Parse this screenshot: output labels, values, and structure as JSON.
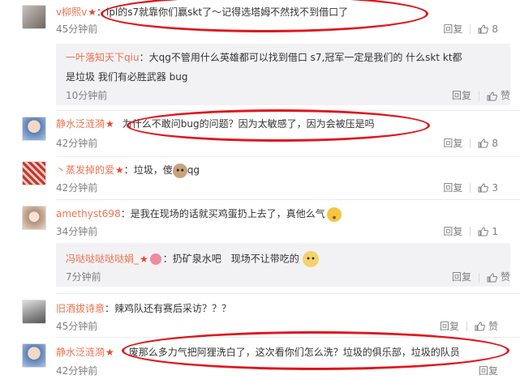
{
  "comments": [
    {
      "name": "v柳熙v",
      "badge": "★",
      "sep": "：",
      "text": "lpl的s7就靠你们赢skt了～记得选塔姆不然找不到借口了",
      "time": "45分钟前",
      "reply": "回复",
      "likes": "8"
    },
    {
      "name": "一叶落知天下qiu",
      "sep": "：",
      "text_line1": "大qg不管用什么英雄都可以找到借口 s7,冠军一定是我们的 什么skt kt都",
      "text_line2": "是垃圾 我们有必胜武器 bug",
      "time": "10分钟前",
      "reply": "回复",
      "like_label": "赞"
    },
    {
      "name": "静水泛涟漪",
      "badge": "★",
      "text": "为什么不敢问bug的问题？因为太敏感了，因为会被压是吗",
      "time": "42分钟前",
      "reply": "回复",
      "likes": "8"
    },
    {
      "name": "丶蒸发掉的爱",
      "badge": "★",
      "sep": "：",
      "text_before": "垃圾，傻",
      "text_after": "qg",
      "time": "42分钟前",
      "reply": "回复",
      "likes": "3"
    },
    {
      "name": "amethyst698",
      "sep": "：",
      "text": "是我在现场的话就买鸡蛋扔上去了，真他么气",
      "time": "34分钟前",
      "reply": "回复",
      "likes": "1"
    },
    {
      "name": "冯哒哒哒哒哒娟_",
      "badge": "★",
      "sep": "：",
      "text": "扔矿泉水吧　现场不让带吃的",
      "time": "7分钟前",
      "reply": "回复",
      "like_label": "赞"
    },
    {
      "name": "旧酒拔诗意",
      "sep": "：",
      "text": "辣鸡队还有赛后采访？？？",
      "time": "45分钟前",
      "reply": "回复",
      "like_label": "赞"
    },
    {
      "name": "静水泛涟漪",
      "badge": "★",
      "text": "废那么多力气把阿狸洗白了，这次看你们怎么洗？垃圾的俱乐部，垃圾的队员",
      "time": "42分钟前",
      "reply": "回复"
    }
  ],
  "colors": {
    "name": "#eb7350",
    "annotation": "#e0161d",
    "time": "#808080",
    "quote_bg": "#f2f2f5"
  },
  "icons": [
    "thumb-up-icon",
    "vip-badge-icon",
    "dog-emoji-icon",
    "angry-emoji-icon",
    "cat-emoji-icon"
  ]
}
